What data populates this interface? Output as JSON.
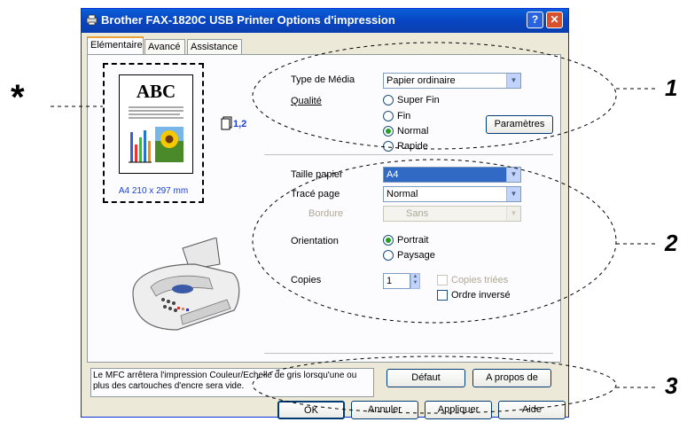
{
  "window": {
    "title": "Brother  FAX-1820C USB Printer Options d'impression",
    "help_glyph": "?",
    "close_glyph": "✕"
  },
  "tabs": [
    {
      "label": "Elémentaire",
      "active": true
    },
    {
      "label": "Avancé",
      "active": false
    },
    {
      "label": "Assistance",
      "active": false
    }
  ],
  "preview": {
    "page_heading": "ABC",
    "size_label": "A4 210 x 297 mm",
    "copies_icon_text": "1,2"
  },
  "media": {
    "type_label": "Type de Média",
    "type_value": "Papier ordinaire",
    "quality_label": "Qualité",
    "quality_options": [
      "Super Fin",
      "Fin",
      "Normal",
      "Rapide"
    ],
    "quality_selected": "Normal",
    "settings_button": "Paramètres"
  },
  "paper": {
    "size_label": "Taille papier",
    "size_value": "A4",
    "layout_label": "Tracé page",
    "layout_value": "Normal",
    "border_label": "Bordure",
    "border_value": "Sans"
  },
  "orientation": {
    "label": "Orientation",
    "options": [
      "Portrait",
      "Paysage"
    ],
    "selected": "Portrait"
  },
  "copies": {
    "label": "Copies",
    "value": "1",
    "collate_label": "Copies triées",
    "reverse_label": "Ordre inversé"
  },
  "footer": {
    "message": "Le MFC arrêtera l'impression Couleur/Echelle de gris lorsqu'une ou plus des cartouches d'encre sera vide.",
    "default_button": "Défaut",
    "about_button": "A propos de",
    "ok_button": "OK",
    "cancel_button": "Annuler",
    "apply_button": "Appliquer",
    "help_button": "Aide"
  },
  "annotations": {
    "asterisk": "*",
    "one": "1",
    "two": "2",
    "three": "3"
  },
  "colors": {
    "titlebar": "#0a5fd8",
    "selection": "#316ac5",
    "radio_dot": "#21a121"
  }
}
